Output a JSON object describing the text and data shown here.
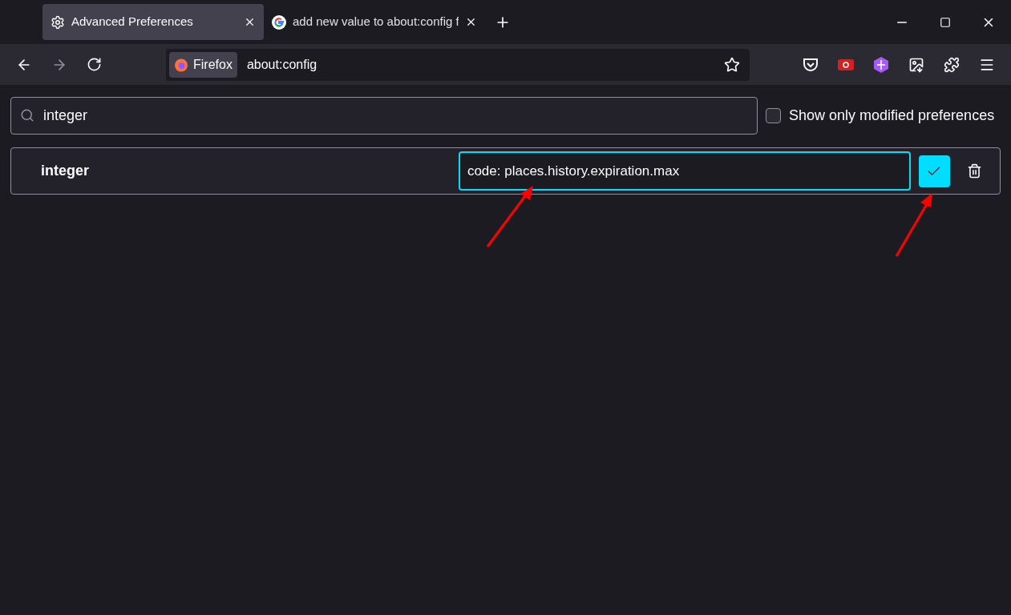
{
  "tabs": [
    {
      "kind": "settings",
      "title": "Advanced Preferences",
      "selected": true
    },
    {
      "kind": "google",
      "title": "add new value to about:config f",
      "selected": false
    }
  ],
  "url_bar": {
    "identity": "Firefox",
    "url": "about:config"
  },
  "search": {
    "value": "integer"
  },
  "modified_only": {
    "label": "Show only modified preferences",
    "checked": false
  },
  "new_pref": {
    "name": "integer",
    "value": "code: places.history.expiration.max"
  }
}
